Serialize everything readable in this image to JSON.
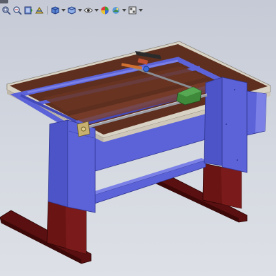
{
  "toolbar": {
    "items": [
      {
        "icon": "zoom-to-fit-icon"
      },
      {
        "icon": "zoom-to-area-icon"
      },
      {
        "icon": "previous-view-icon"
      },
      {
        "icon": "section-view-icon"
      },
      {
        "icon": "view-orientation-icon",
        "dropdown": true
      },
      {
        "icon": "display-style-icon",
        "dropdown": true
      },
      {
        "icon": "hide-show-items-icon",
        "dropdown": true
      },
      {
        "icon": "edit-appearance-icon"
      },
      {
        "icon": "apply-scene-icon",
        "dropdown": true
      },
      {
        "icon": "view-settings-icon",
        "dropdown": true
      }
    ]
  },
  "colors": {
    "background_top": "#c5cad6",
    "background_bottom": "#dde0e6",
    "frame_blue": "#5c63d8",
    "frame_blue_dark": "#3f45a8",
    "wood": "#5e2f1f",
    "wood_light": "#7a3f2a",
    "tabletop_edge": "#d8d2c4",
    "base_dark_red": "#5a1010",
    "leadscrew_green": "#3e8a3a",
    "rod_gray": "#9a9ca4"
  }
}
